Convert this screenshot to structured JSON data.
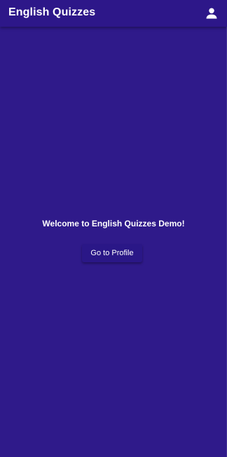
{
  "app_bar": {
    "title": "English Quizzes",
    "profile_icon": "person-icon"
  },
  "main": {
    "welcome_text": "Welcome to English Quizzes Demo!",
    "profile_button_label": "Go to Profile"
  },
  "colors": {
    "background": "#2f1a8a",
    "app_bar": "#2d1789",
    "text": "#ffffff"
  }
}
